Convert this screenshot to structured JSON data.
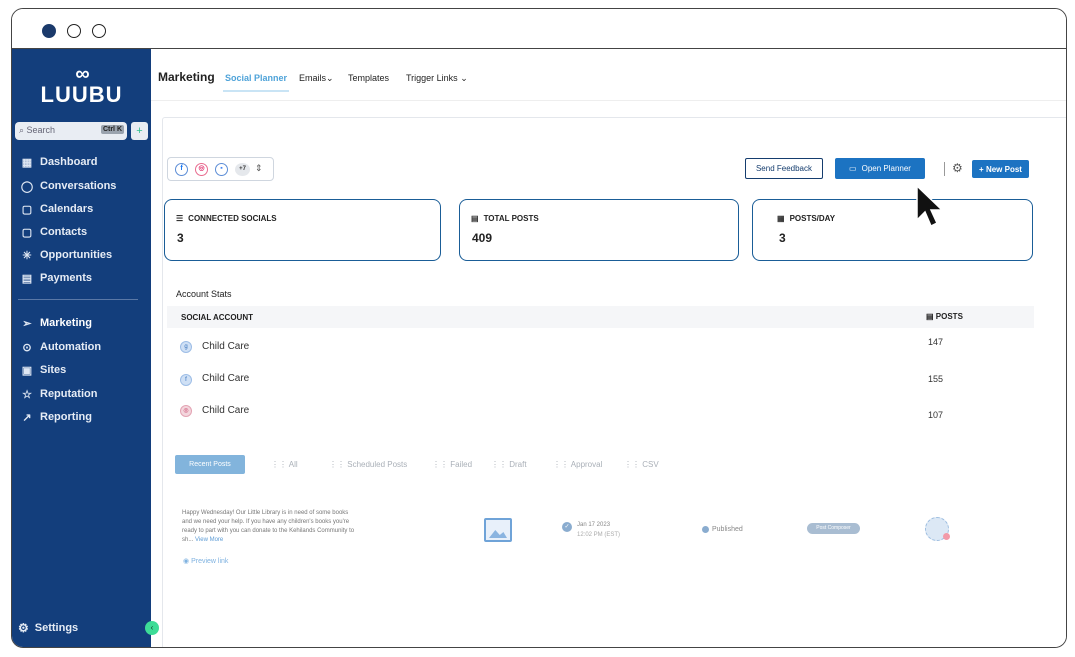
{
  "window": {
    "controls": [
      "close",
      "minimize",
      "maximize"
    ]
  },
  "brand": {
    "name": "LUUBU",
    "symbol": "∞"
  },
  "search": {
    "placeholder": "Search",
    "shortcut": "Ctrl K"
  },
  "sidebar": {
    "items": [
      {
        "label": "Dashboard",
        "icon": "dashboard-icon"
      },
      {
        "label": "Conversations",
        "icon": "chat-icon"
      },
      {
        "label": "Calendars",
        "icon": "calendar-icon"
      },
      {
        "label": "Contacts",
        "icon": "contacts-icon"
      },
      {
        "label": "Opportunities",
        "icon": "opportunities-icon"
      },
      {
        "label": "Payments",
        "icon": "payments-icon"
      },
      {
        "label": "Marketing",
        "icon": "send-icon",
        "active": true
      },
      {
        "label": "Automation",
        "icon": "automation-icon"
      },
      {
        "label": "Sites",
        "icon": "sites-icon"
      },
      {
        "label": "Reputation",
        "icon": "star-icon"
      },
      {
        "label": "Reporting",
        "icon": "trend-icon"
      }
    ],
    "settings_label": "Settings"
  },
  "topnav": {
    "title": "Marketing",
    "tabs": [
      {
        "label": "Social Planner",
        "active": true
      },
      {
        "label": "Emails"
      },
      {
        "label": "Templates"
      },
      {
        "label": "Trigger Links"
      }
    ]
  },
  "toolbar": {
    "social_more": "+7",
    "feedback_label": "Send Feedback",
    "planner_label": "Open Planner",
    "new_post_label": "+ New Post"
  },
  "stats": [
    {
      "label": "CONNECTED SOCIALS",
      "value": "3"
    },
    {
      "label": "TOTAL POSTS",
      "value": "409"
    },
    {
      "label": "POSTS/DAY",
      "value": "3"
    }
  ],
  "account_stats": {
    "title": "Account Stats",
    "columns": [
      "SOCIAL ACCOUNT",
      "POSTS"
    ],
    "rows": [
      {
        "name": "Child Care",
        "posts": "147"
      },
      {
        "name": "Child Care",
        "posts": "155"
      },
      {
        "name": "Child Care",
        "posts": "107"
      }
    ]
  },
  "filters": {
    "active": "Recent Posts",
    "items": [
      "All",
      "Scheduled Posts",
      "Failed",
      "Draft",
      "Approval",
      "CSV"
    ]
  },
  "post": {
    "text": "Happy Wednesday! Our Little Library is in need of some books and we need your help. If you have any children's books you're ready to part with you can donate to the Kehilands Community to sh...",
    "view_more": "View More",
    "preview": "Preview link",
    "date": "Jan 17 2023",
    "time": "12:02 PM (EST)",
    "status": "Published",
    "source": "Post Composer"
  },
  "colors": {
    "sidebar": "#133e7c",
    "primary": "#1c73c2",
    "accent": "#4fa3d9"
  }
}
